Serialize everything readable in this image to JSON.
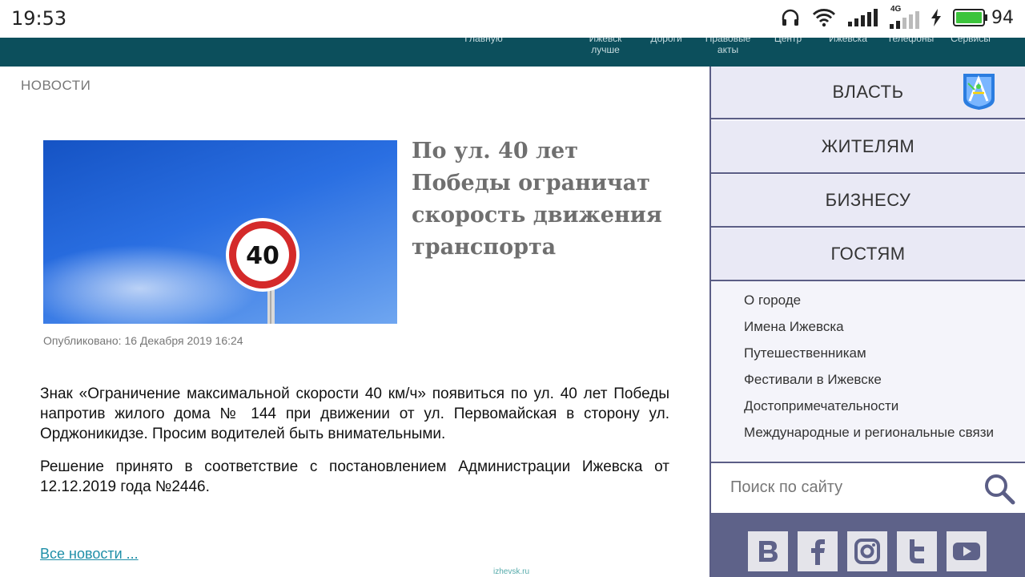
{
  "status_bar": {
    "time": "19:53",
    "network_label": "4G",
    "battery_percent": "94",
    "icons": [
      "headphones-icon",
      "wifi-icon",
      "signal-icon",
      "signal-4g-icon",
      "charging-icon",
      "battery-icon"
    ]
  },
  "top_nav": {
    "items": [
      "Главную",
      "Ижевск лучше",
      "Дороги",
      "Правовые акты",
      "Центр",
      "Ижевска",
      "Телефоны",
      "Сервисы"
    ]
  },
  "section_label": "НОВОСТИ",
  "article": {
    "title": "По ул. 40 лет Победы ограничат скорость движения транспорта",
    "image_sign_text": "40",
    "published": "Опубликовано: 16 Декабря 2019 16:24",
    "paragraphs": [
      "Знак «Ограничение максимальной скорости 40 км/ч» появиться по ул. 40 лет Победы напротив жилого дома № 144 при движении от ул. Первомайская в сторону ул. Орджоникидзе. Просим водителей быть внимательными.",
      "Решение принято в соответствие с постановлением Администрации Ижевска от 12.12.2019 года №2446."
    ],
    "all_news_link": "Все новости ..."
  },
  "footer_url": "izhevsk.ru",
  "sidebar": {
    "menu": [
      "ВЛАСТЬ",
      "ЖИТЕЛЯМ",
      "БИЗНЕСУ",
      "ГОСТЯМ"
    ],
    "sub_links": [
      "О городе",
      "Имена Ижевска",
      "Путешественникам",
      "Фестивали в Ижевске",
      "Достопримечательности",
      "Международные и региональные связи"
    ],
    "search_placeholder": "Поиск по сайту",
    "social": [
      "vk-icon",
      "facebook-icon",
      "instagram-icon",
      "twitter-icon",
      "youtube-icon"
    ]
  },
  "colors": {
    "nav_bg": "#0c4f5c",
    "sidebar_border": "#5b5e86",
    "menu_bg": "#e9e9f5",
    "social_bar_bg": "#5e6289",
    "headline": "#6f6f6f",
    "link": "#1f8fa8",
    "battery": "#3cc43c"
  }
}
